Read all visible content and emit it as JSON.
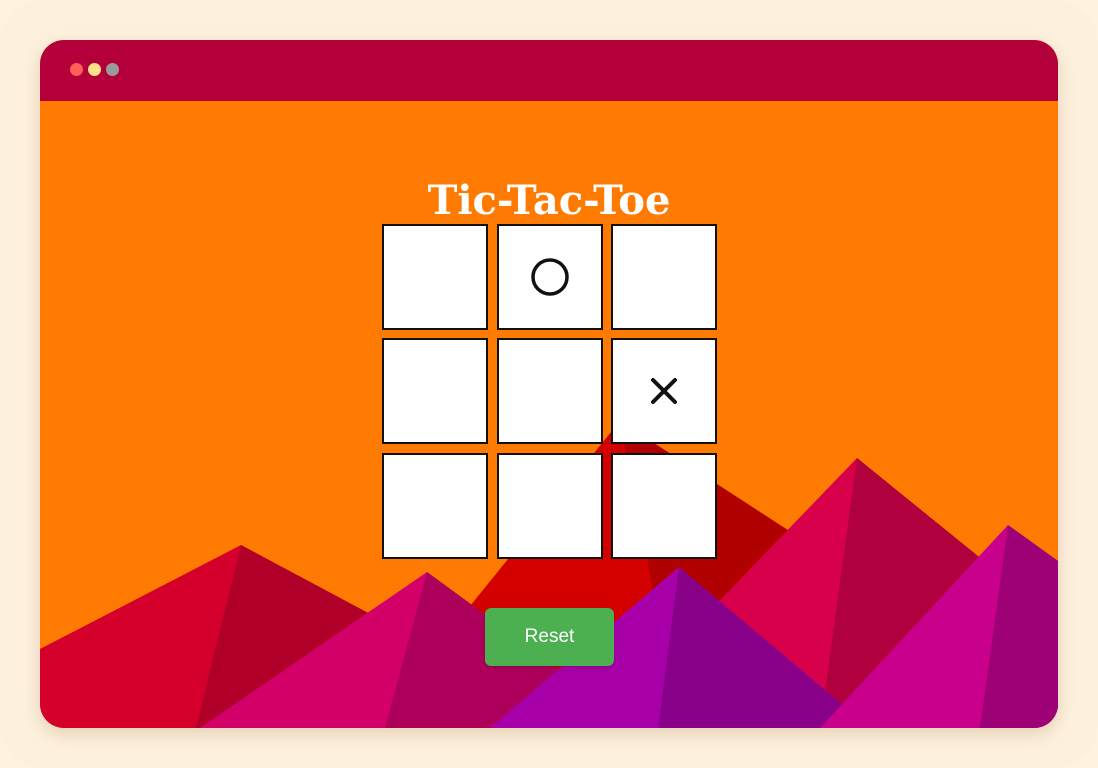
{
  "window": {
    "controls": [
      {
        "name": "close",
        "color": "#ff5f57"
      },
      {
        "name": "minimize",
        "color": "#ffe08a"
      },
      {
        "name": "maximize",
        "color": "#9a9a9a"
      }
    ],
    "titlebar_color": "#b3003a"
  },
  "game": {
    "title": "Tic-Tac-Toe",
    "board": [
      "",
      "O",
      "",
      "",
      "",
      "X",
      "",
      "",
      ""
    ],
    "reset_label": "Reset"
  },
  "colors": {
    "background": "#ff7a00",
    "cell": "#ffffff",
    "cell_border": "#111111",
    "mark": "#111111",
    "reset_button": "#4caf50"
  }
}
